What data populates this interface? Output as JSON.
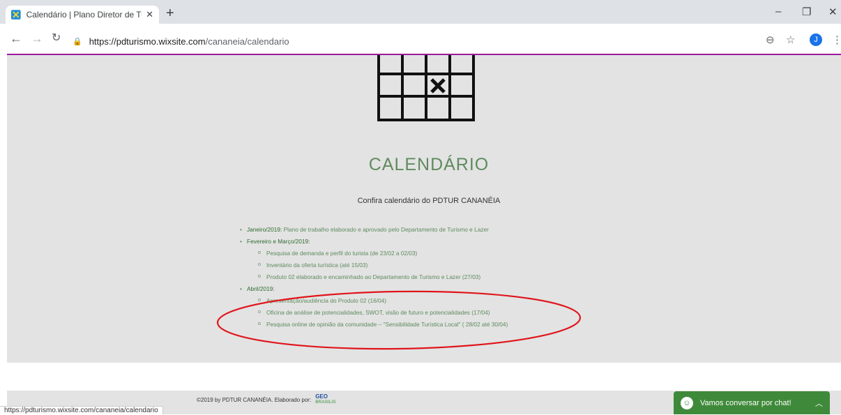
{
  "browser": {
    "tab_title": "Calendário | Plano Diretor de Tur",
    "new_tab": "+",
    "url_host": "https://pdturismo.wixsite.com",
    "url_path": "/cananeia/calendario",
    "profile_initial": "J",
    "status_url": "https://pdturismo.wixsite.com/cananeia/calendario"
  },
  "page": {
    "title": "CALENDÁRIO",
    "subtitle": "Confira calendário do PDTUR CANANÉIA",
    "events": {
      "jan_label": "Janeiro/2019:",
      "jan_text": " Plano de trabalho elaborado e aprovado pelo Departamento de Turismo e Lazer",
      "fev_label": "Fevereiro e Março/2019:",
      "fev_items": [
        "Pesquisa de demanda e perfil do turista (de 23/02 a 02/03)",
        "Inventário da oferta turística (até 15/03)",
        "Produto 02 elaborado e encaminhado ao Departamento de Turismo e Lazer (27/03)"
      ],
      "abr_label": "Abril/2019:",
      "abr_items": [
        "Apresentação/audiência do Produto 02 (16/04)",
        "Oficina de análise de potencialidades, SWOT, visão de futuro e potencialidades (17/04)",
        "Pesquisa online de opinião da comunidade – \"Sensibilidade Turística Local\" ( 28/02 até 30/04)"
      ]
    }
  },
  "footer": {
    "copyright": "©2019 by PDTUR CANANÉIA.  Elaborado por:",
    "logo_top": "GEO",
    "logo_bottom": "BRASILIS"
  },
  "chat": {
    "label": "Vamos conversar por chat!",
    "icon": "chat-bubble-icon"
  },
  "colors": {
    "accent_green": "#5f8b5f",
    "chat_green": "#3f8a3a",
    "annotation_red": "#e0151b"
  }
}
